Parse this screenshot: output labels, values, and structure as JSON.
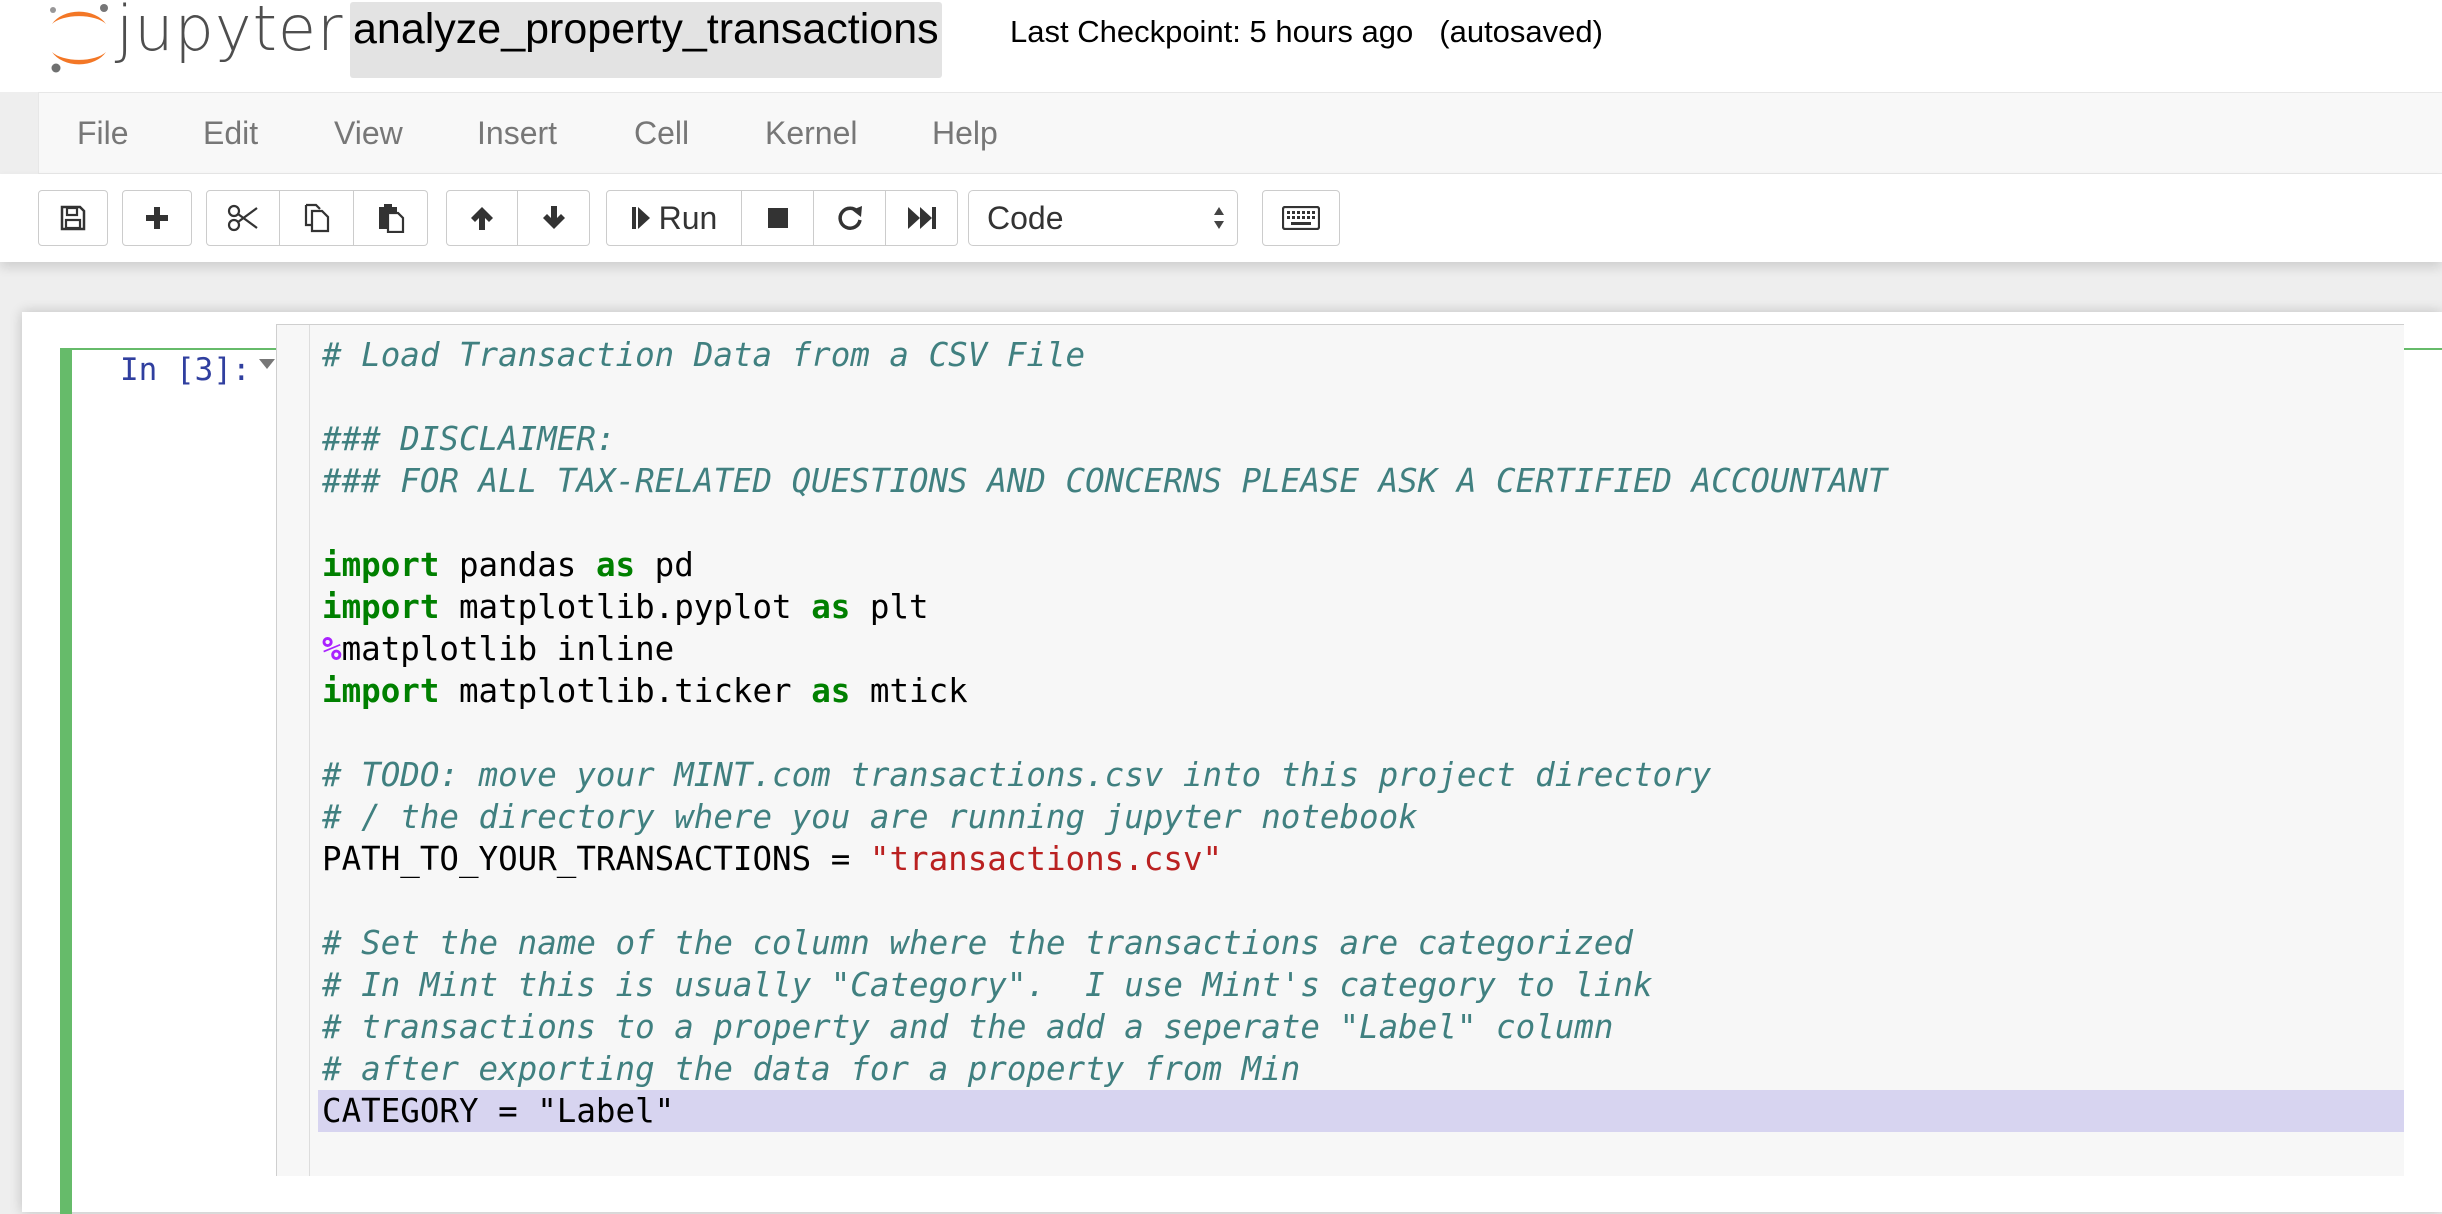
{
  "header": {
    "logo_text": "jupyter",
    "notebook_title": "analyze_property_transactions",
    "checkpoint": "Last Checkpoint: 5 hours ago",
    "autosave": "(autosaved)"
  },
  "menubar": {
    "items": [
      {
        "label": "File"
      },
      {
        "label": "Edit"
      },
      {
        "label": "View"
      },
      {
        "label": "Insert"
      },
      {
        "label": "Cell"
      },
      {
        "label": "Kernel"
      },
      {
        "label": "Help"
      }
    ]
  },
  "toolbar": {
    "icons": {
      "save": "save-icon",
      "insert": "plus-icon",
      "cut": "scissors-icon",
      "copy": "copy-icon",
      "paste": "paste-icon",
      "move_up": "arrow-up-icon",
      "move_down": "arrow-down-icon",
      "run": "step-forward-icon",
      "interrupt": "stop-icon",
      "restart": "restart-icon",
      "restart_run_all": "fast-forward-icon",
      "command_palette": "keyboard-icon"
    },
    "run_label": "Run",
    "cell_type": "Code"
  },
  "cell": {
    "prompt": "In [3]:",
    "accent_color": "#66bb6a",
    "code_lines": [
      [
        {
          "t": "comment",
          "s": "# Load Transaction Data from a CSV File"
        }
      ],
      [],
      [
        {
          "t": "comment",
          "s": "### DISCLAIMER:"
        }
      ],
      [
        {
          "t": "comment",
          "s": "### FOR ALL TAX-RELATED QUESTIONS AND CONCERNS PLEASE ASK A CERTIFIED ACCOUNTANT"
        }
      ],
      [],
      [
        {
          "t": "keyword",
          "s": "import"
        },
        {
          "t": "plain",
          "s": " pandas "
        },
        {
          "t": "keyword",
          "s": "as"
        },
        {
          "t": "plain",
          "s": " pd"
        }
      ],
      [
        {
          "t": "keyword",
          "s": "import"
        },
        {
          "t": "plain",
          "s": " matplotlib.pyplot "
        },
        {
          "t": "keyword",
          "s": "as"
        },
        {
          "t": "plain",
          "s": " plt"
        }
      ],
      [
        {
          "t": "magic",
          "s": "%"
        },
        {
          "t": "plain",
          "s": "matplotlib inline"
        }
      ],
      [
        {
          "t": "keyword",
          "s": "import"
        },
        {
          "t": "plain",
          "s": " matplotlib.ticker "
        },
        {
          "t": "keyword",
          "s": "as"
        },
        {
          "t": "plain",
          "s": " mtick"
        }
      ],
      [],
      [
        {
          "t": "comment",
          "s": "# TODO: move your MINT.com transactions.csv into this project directory"
        }
      ],
      [
        {
          "t": "comment",
          "s": "# / the directory where you are running jupyter notebook"
        }
      ],
      [
        {
          "t": "plain",
          "s": "PATH_TO_YOUR_TRANSACTIONS = "
        },
        {
          "t": "string",
          "s": "\"transactions.csv\""
        }
      ],
      [],
      [
        {
          "t": "comment",
          "s": "# Set the name of the column where the transactions are categorized"
        }
      ],
      [
        {
          "t": "comment",
          "s": "# In Mint this is usually \"Category\".  I use Mint's category to link"
        }
      ],
      [
        {
          "t": "comment",
          "s": "# transactions to a property and the add a seperate \"Label\" column"
        }
      ],
      [
        {
          "t": "comment",
          "s": "# after exporting the data for a property from Min"
        }
      ],
      [
        {
          "t": "plain",
          "s": "CATEGORY = "
        },
        {
          "t": "string",
          "s": "\"Label\""
        }
      ]
    ],
    "selected_line_index": 18
  }
}
